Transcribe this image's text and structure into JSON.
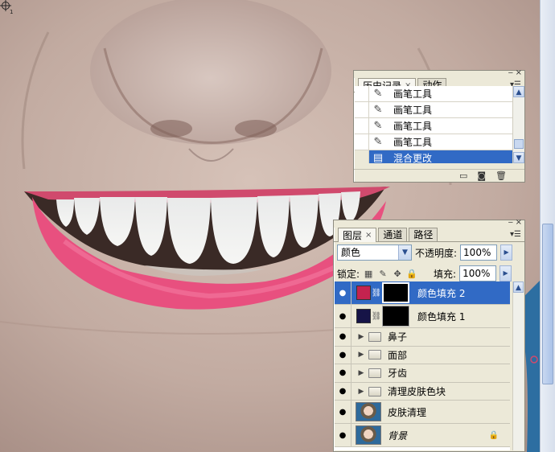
{
  "history_panel": {
    "tabs": [
      {
        "label": "历史记录",
        "active": true
      },
      {
        "label": "动作",
        "active": false
      }
    ],
    "items": [
      {
        "label": "画笔工具",
        "icon": "brush-icon",
        "selected": false
      },
      {
        "label": "画笔工具",
        "icon": "brush-icon",
        "selected": false
      },
      {
        "label": "画笔工具",
        "icon": "brush-icon",
        "selected": false
      },
      {
        "label": "画笔工具",
        "icon": "brush-icon",
        "selected": false
      },
      {
        "label": "混合更改",
        "icon": "history-state-icon",
        "selected": true
      }
    ]
  },
  "layers_panel": {
    "tabs": [
      {
        "label": "图层",
        "active": true
      },
      {
        "label": "通道",
        "active": false
      },
      {
        "label": "路径",
        "active": false
      }
    ],
    "blend_mode": "颜色",
    "opacity_label": "不透明度:",
    "opacity_value": "100%",
    "lock_label": "锁定:",
    "fill_label": "填充:",
    "fill_value": "100%",
    "layers": [
      {
        "name": "颜色填充 2",
        "kind": "fill",
        "swatch": "#c4234f",
        "selected": true
      },
      {
        "name": "颜色填充 1",
        "kind": "fill",
        "swatch": "#161447",
        "selected": false
      },
      {
        "name": "鼻子",
        "kind": "group",
        "selected": false
      },
      {
        "name": "面部",
        "kind": "group",
        "selected": false
      },
      {
        "name": "牙齿",
        "kind": "group",
        "selected": false
      },
      {
        "name": "清理皮肤色块",
        "kind": "group",
        "selected": false
      },
      {
        "name": "皮肤清理",
        "kind": "image",
        "selected": false
      },
      {
        "name": "背景",
        "kind": "image",
        "locked": true,
        "selected": false
      }
    ]
  },
  "canvas": {
    "cursor_icon": "brush-crosshair-icon",
    "lip_color": "#e8507f"
  }
}
